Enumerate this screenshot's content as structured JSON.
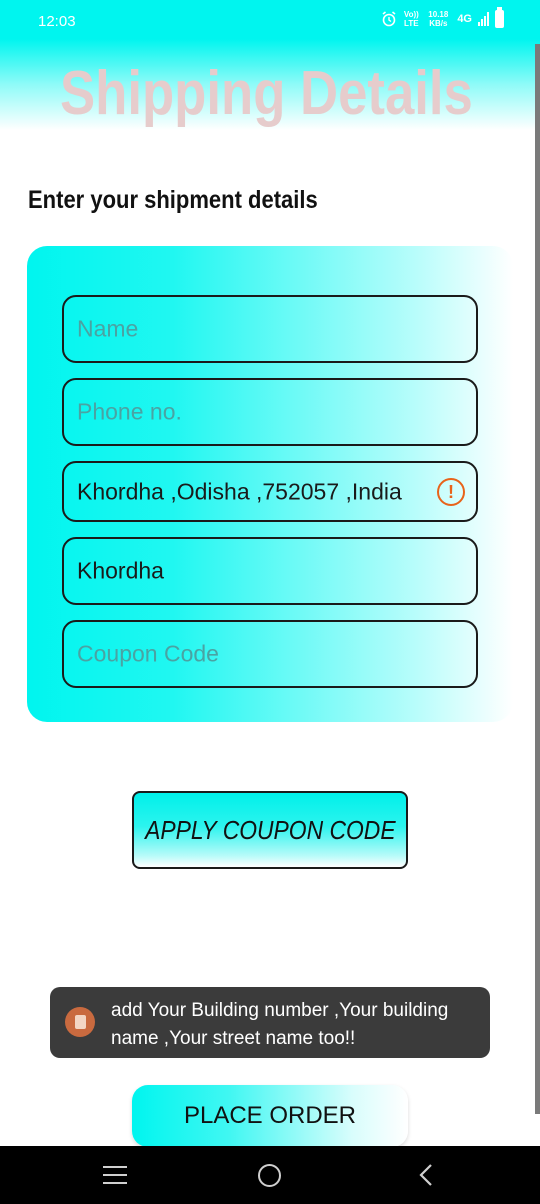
{
  "status_bar": {
    "time": "12:03",
    "volte": "Vo)) LTE",
    "speed": "10.18 KB/s",
    "network": "4G"
  },
  "header": {
    "title": "Shipping Details"
  },
  "form": {
    "subtitle": "Enter your shipment details",
    "fields": [
      {
        "name": "name",
        "value": "",
        "placeholder": "Name"
      },
      {
        "name": "phone",
        "value": "",
        "placeholder": "Phone no."
      },
      {
        "name": "address",
        "value": "Khordha ,Odisha ,752057 ,India",
        "placeholder": "",
        "warning": "!"
      },
      {
        "name": "city",
        "value": "Khordha",
        "placeholder": ""
      },
      {
        "name": "coupon",
        "value": "",
        "placeholder": "Coupon Code"
      }
    ]
  },
  "buttons": {
    "apply_coupon": "APPLY COUPON CODE",
    "place_order": "PLACE ORDER"
  },
  "toast": {
    "message": "add Your Building number ,Your building name ,Your street name  too!!",
    "icon": "shop-cart-icon"
  },
  "colors": {
    "accent": "#00f5ef",
    "title": "#e6cccc",
    "warning": "#e8631a",
    "toast_bg": "#3b3b3b"
  }
}
